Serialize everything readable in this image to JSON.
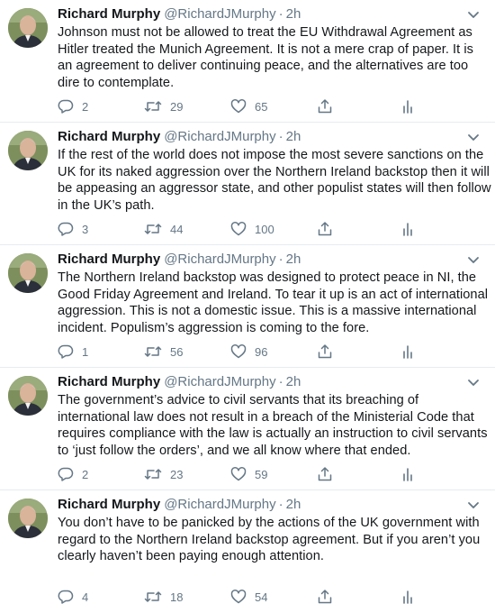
{
  "colors": {
    "text": "#14171a",
    "muted": "#657786",
    "divider": "#e6ecf0"
  },
  "icons": {
    "reply": "speech-bubble-icon",
    "retweet": "retweet-arrows-icon",
    "like": "heart-icon",
    "share": "share-upload-icon",
    "analytics": "bar-chart-icon",
    "menu": "chevron-down-icon"
  },
  "tweets": [
    {
      "name": "Richard Murphy",
      "handle": "@RichardJMurphy",
      "separator": "·",
      "time": "2h",
      "text": "Johnson must not be allowed to treat the EU Withdrawal Agreement as Hitler treated the Munich Agreement. It is not a mere crap of paper. It is an agreement to deliver continuing peace, and the alternatives are too dire to contemplate.",
      "replies": "2",
      "retweets": "29",
      "likes": "65"
    },
    {
      "name": "Richard Murphy",
      "handle": "@RichardJMurphy",
      "separator": "·",
      "time": "2h",
      "text": "If the rest of the world does not impose the most severe sanctions on the UK for its naked aggression over the Northern Ireland backstop then it will be appeasing an aggressor state, and other populist states will then follow in the UK’s path.",
      "replies": "3",
      "retweets": "44",
      "likes": "100"
    },
    {
      "name": "Richard Murphy",
      "handle": "@RichardJMurphy",
      "separator": "·",
      "time": "2h",
      "text": "The Northern Ireland backstop was designed to protect peace in NI, the Good Friday Agreement and Ireland. To tear it up is an act of international aggression. This is not a domestic issue. This is a massive international incident. Populism’s aggression is coming to the fore.",
      "replies": "1",
      "retweets": "56",
      "likes": "96"
    },
    {
      "name": "Richard Murphy",
      "handle": "@RichardJMurphy",
      "separator": "·",
      "time": "2h",
      "text": "The government’s advice to civil servants that its breaching of international law does not result in a breach of the Ministerial Code that requires compliance with the law is actually an instruction to civil servants to ‘just follow the orders’, and we all know where that ended.",
      "replies": "2",
      "retweets": "23",
      "likes": "59"
    },
    {
      "name": "Richard Murphy",
      "handle": "@RichardJMurphy",
      "separator": "·",
      "time": "2h",
      "text": "You don’t have to be panicked by the actions of the UK government with regard to the Northern Ireland backstop agreement. But if you aren’t you clearly haven’t been paying enough attention.",
      "replies": "4",
      "retweets": "18",
      "likes": "54"
    }
  ]
}
